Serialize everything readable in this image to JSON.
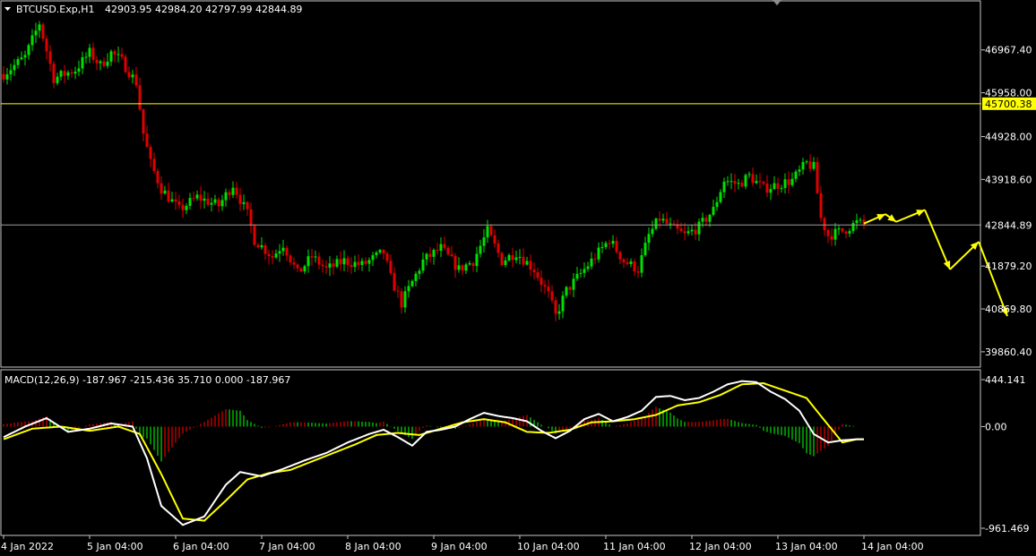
{
  "header": {
    "symbol": "BTCUSD.Exp,H1",
    "ohlc": "42903.95 42984.20 42797.99 42844.89"
  },
  "macd": {
    "title": "MACD(12,26,9) -187.967 -215.436 35.710 0.000 -187.967"
  },
  "colors": {
    "background": "#000000",
    "frame": "#c8c8c8",
    "bull": "#00e000",
    "bear": "#e00000",
    "resistance": "#ffff00",
    "current_line": "#a0a0a0",
    "macd_line": "#ffffff",
    "signal_line": "#ffff00",
    "forecast": "#ffff00"
  },
  "chart_data": [
    {
      "type": "candlestick",
      "panel": "price",
      "symbol": "BTCUSD.Exp",
      "timeframe": "H1",
      "y_ticks": [
        "46967.40",
        "45958.00",
        "44928.00",
        "43918.60",
        "42844.89",
        "41879.20",
        "40869.80",
        "39860.40"
      ],
      "y_tick_values": [
        46967.4,
        45958.0,
        44928.0,
        43918.6,
        42844.89,
        41879.2,
        40869.8,
        39860.4
      ],
      "ylim": [
        39500,
        48100
      ],
      "x_ticks": [
        "4 Jan 2022",
        "5 Jan 04:00",
        "6 Jan 04:00",
        "7 Jan 04:00",
        "8 Jan 04:00",
        "9 Jan 04:00",
        "10 Jan 04:00",
        "11 Jan 04:00",
        "12 Jan 04:00",
        "13 Jan 04:00",
        "14 Jan 04:00"
      ],
      "horizontal_lines": [
        {
          "value": 45700.38,
          "label": "45700.38",
          "role": "resistance"
        },
        {
          "value": 42844.89,
          "label": "42844.89",
          "role": "current"
        }
      ],
      "anchors": [
        [
          0,
          46400
        ],
        [
          6,
          46800
        ],
        [
          10,
          47600
        ],
        [
          14,
          46300
        ],
        [
          20,
          46500
        ],
        [
          24,
          46900
        ],
        [
          27,
          46600
        ],
        [
          30,
          46900
        ],
        [
          33,
          46700
        ],
        [
          37,
          46200
        ],
        [
          39,
          45000
        ],
        [
          41,
          44300
        ],
        [
          44,
          43700
        ],
        [
          49,
          43200
        ],
        [
          54,
          43500
        ],
        [
          60,
          43300
        ],
        [
          64,
          43800
        ],
        [
          68,
          43100
        ],
        [
          70,
          42500
        ],
        [
          75,
          42100
        ],
        [
          78,
          42400
        ],
        [
          82,
          41700
        ],
        [
          86,
          42100
        ],
        [
          90,
          41800
        ],
        [
          95,
          42000
        ],
        [
          100,
          41900
        ],
        [
          106,
          42200
        ],
        [
          108,
          41600
        ],
        [
          111,
          41000
        ],
        [
          114,
          41500
        ],
        [
          117,
          42000
        ],
        [
          122,
          42300
        ],
        [
          127,
          41800
        ],
        [
          131,
          42000
        ],
        [
          135,
          42700
        ],
        [
          139,
          42000
        ],
        [
          143,
          42200
        ],
        [
          148,
          41800
        ],
        [
          152,
          41200
        ],
        [
          154,
          40700
        ],
        [
          157,
          41300
        ],
        [
          161,
          41700
        ],
        [
          165,
          42100
        ],
        [
          169,
          42500
        ],
        [
          173,
          42000
        ],
        [
          177,
          41800
        ],
        [
          180,
          42600
        ],
        [
          183,
          43000
        ],
        [
          186,
          42800
        ],
        [
          190,
          42600
        ],
        [
          194,
          42800
        ],
        [
          198,
          43200
        ],
        [
          201,
          43900
        ],
        [
          205,
          43800
        ],
        [
          208,
          44000
        ],
        [
          212,
          43700
        ],
        [
          216,
          43800
        ],
        [
          220,
          43900
        ],
        [
          224,
          44300
        ],
        [
          226,
          44200
        ],
        [
          228,
          43000
        ],
        [
          230,
          42600
        ],
        [
          234,
          42700
        ],
        [
          238,
          42900
        ],
        [
          240,
          42850
        ]
      ],
      "forecast_path": [
        [
          240,
          42880
        ],
        [
          246,
          43100
        ],
        [
          249,
          42920
        ],
        [
          257,
          43200
        ],
        [
          264,
          41800
        ],
        [
          272,
          42450
        ],
        [
          280,
          40700
        ]
      ]
    },
    {
      "type": "macd",
      "panel": "macd",
      "params": "12,26,9",
      "y_ticks": [
        "444.141",
        "0.00",
        "-961.469"
      ],
      "y_tick_values": [
        444.141,
        0.0,
        -961.469
      ],
      "ylim": [
        -961.469,
        444.141
      ],
      "macd_anchors": [
        [
          0,
          -100
        ],
        [
          6,
          0
        ],
        [
          12,
          80
        ],
        [
          18,
          -50
        ],
        [
          24,
          -20
        ],
        [
          30,
          30
        ],
        [
          36,
          0
        ],
        [
          40,
          -300
        ],
        [
          44,
          -750
        ],
        [
          50,
          -930
        ],
        [
          56,
          -850
        ],
        [
          62,
          -550
        ],
        [
          66,
          -430
        ],
        [
          72,
          -470
        ],
        [
          78,
          -400
        ],
        [
          84,
          -320
        ],
        [
          90,
          -250
        ],
        [
          96,
          -150
        ],
        [
          102,
          -70
        ],
        [
          106,
          -30
        ],
        [
          110,
          -100
        ],
        [
          114,
          -180
        ],
        [
          118,
          -50
        ],
        [
          122,
          -30
        ],
        [
          126,
          0
        ],
        [
          130,
          70
        ],
        [
          134,
          130
        ],
        [
          138,
          100
        ],
        [
          142,
          80
        ],
        [
          146,
          50
        ],
        [
          150,
          -40
        ],
        [
          154,
          -110
        ],
        [
          158,
          -40
        ],
        [
          162,
          70
        ],
        [
          166,
          120
        ],
        [
          170,
          50
        ],
        [
          174,
          90
        ],
        [
          178,
          150
        ],
        [
          182,
          280
        ],
        [
          186,
          290
        ],
        [
          190,
          250
        ],
        [
          194,
          270
        ],
        [
          198,
          330
        ],
        [
          202,
          400
        ],
        [
          206,
          430
        ],
        [
          210,
          420
        ],
        [
          214,
          330
        ],
        [
          218,
          260
        ],
        [
          222,
          150
        ],
        [
          226,
          -70
        ],
        [
          230,
          -150
        ],
        [
          234,
          -130
        ],
        [
          238,
          -120
        ]
      ],
      "signal_anchors": [
        [
          0,
          -120
        ],
        [
          8,
          -20
        ],
        [
          16,
          0
        ],
        [
          24,
          -40
        ],
        [
          32,
          0
        ],
        [
          38,
          -70
        ],
        [
          44,
          -450
        ],
        [
          50,
          -870
        ],
        [
          56,
          -890
        ],
        [
          62,
          -700
        ],
        [
          68,
          -500
        ],
        [
          74,
          -440
        ],
        [
          80,
          -410
        ],
        [
          86,
          -330
        ],
        [
          92,
          -250
        ],
        [
          98,
          -170
        ],
        [
          104,
          -80
        ],
        [
          110,
          -60
        ],
        [
          116,
          -80
        ],
        [
          122,
          -20
        ],
        [
          128,
          40
        ],
        [
          134,
          70
        ],
        [
          140,
          40
        ],
        [
          146,
          -50
        ],
        [
          152,
          -60
        ],
        [
          158,
          -30
        ],
        [
          164,
          40
        ],
        [
          170,
          50
        ],
        [
          176,
          70
        ],
        [
          182,
          110
        ],
        [
          188,
          200
        ],
        [
          194,
          230
        ],
        [
          200,
          300
        ],
        [
          206,
          400
        ],
        [
          212,
          410
        ],
        [
          218,
          340
        ],
        [
          224,
          270
        ],
        [
          228,
          100
        ],
        [
          234,
          -150
        ],
        [
          238,
          -120
        ]
      ]
    }
  ]
}
